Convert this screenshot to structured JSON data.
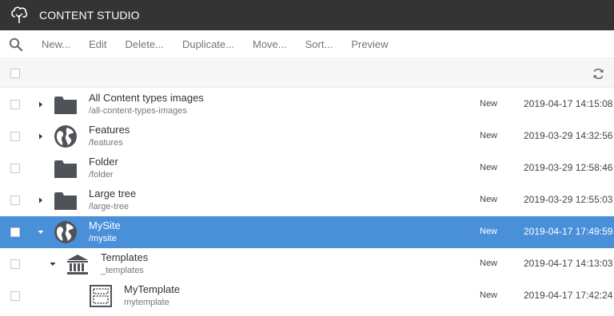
{
  "app": {
    "title": "CONTENT STUDIO"
  },
  "toolbar": {
    "search_icon": "search-icon",
    "buttons": [
      {
        "label": "New..."
      },
      {
        "label": "Edit"
      },
      {
        "label": "Delete..."
      },
      {
        "label": "Duplicate..."
      },
      {
        "label": "Move..."
      },
      {
        "label": "Sort..."
      },
      {
        "label": "Preview"
      }
    ]
  },
  "selection_bar": {
    "refresh_icon": "refresh-icon"
  },
  "colors": {
    "header": "#343434",
    "selected_row": "#4a90d9",
    "icon": "#4f5257"
  },
  "rows": [
    {
      "name": "All Content types images",
      "path": "/all-content-types-images",
      "status": "New",
      "modified": "2019-04-17 14:15:08",
      "icon": "folder-icon",
      "toggle": "collapsed",
      "selected": false,
      "depth": 0
    },
    {
      "name": "Features",
      "path": "/features",
      "status": "New",
      "modified": "2019-03-29 14:32:56",
      "icon": "globe-icon",
      "toggle": "collapsed",
      "selected": false,
      "depth": 0
    },
    {
      "name": "Folder",
      "path": "/folder",
      "status": "New",
      "modified": "2019-03-29 12:58:46",
      "icon": "folder-icon",
      "toggle": "none",
      "selected": false,
      "depth": 0
    },
    {
      "name": "Large tree",
      "path": "/large-tree",
      "status": "New",
      "modified": "2019-03-29 12:55:03",
      "icon": "folder-icon",
      "toggle": "collapsed",
      "selected": false,
      "depth": 0
    },
    {
      "name": "MySite",
      "path": "/mysite",
      "status": "New",
      "modified": "2019-04-17 17:49:59",
      "icon": "globe-icon",
      "toggle": "expanded",
      "selected": true,
      "depth": 0
    },
    {
      "name": "Templates",
      "path": "_templates",
      "status": "New",
      "modified": "2019-04-17 14:13:03",
      "icon": "templates-icon",
      "toggle": "expanded",
      "selected": false,
      "depth": 1
    },
    {
      "name": "MyTemplate",
      "path": "mytemplate",
      "status": "New",
      "modified": "2019-04-17 17:42:24",
      "icon": "page-template-icon",
      "toggle": "none",
      "selected": false,
      "depth": 2
    }
  ]
}
